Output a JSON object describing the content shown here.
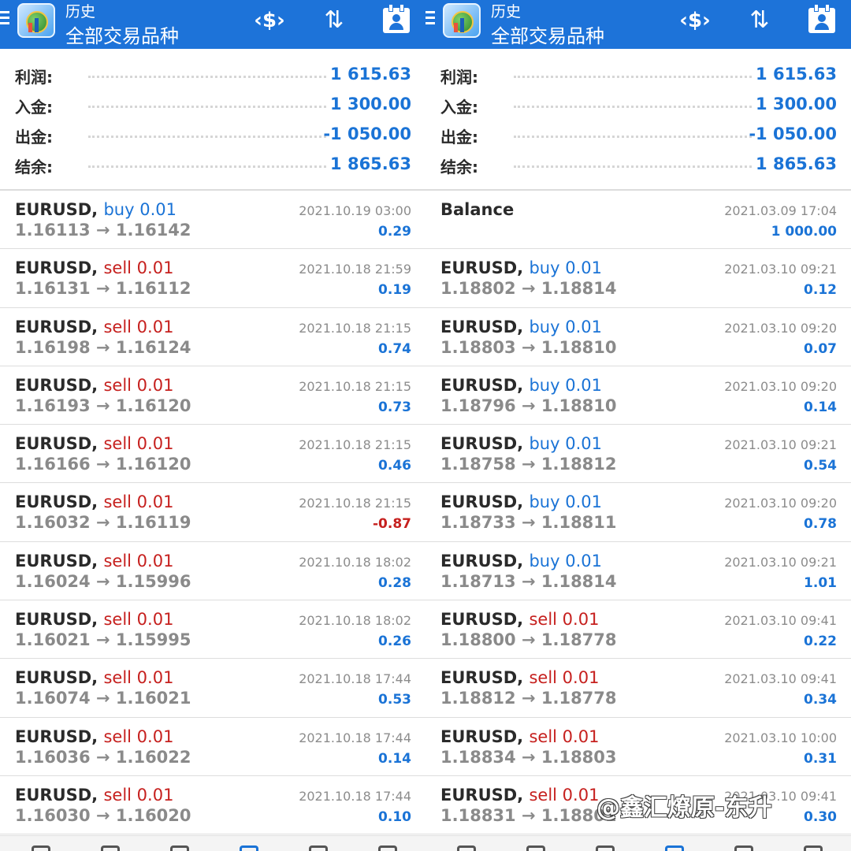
{
  "left": {
    "header": {
      "section": "历史",
      "filter": "全部交易品种"
    },
    "summary": [
      {
        "label": "利润:",
        "value": "1 615.63"
      },
      {
        "label": "入金:",
        "value": "1 300.00"
      },
      {
        "label": "出金:",
        "value": "-1 050.00"
      },
      {
        "label": "结余:",
        "value": "1 865.63"
      }
    ],
    "trades": [
      {
        "symbol": "EURUSD,",
        "side": "buy 0.01",
        "side_type": "buy",
        "prices": "1.16113 → 1.16142",
        "time": "2021.10.19 03:00",
        "profit": "0.29",
        "neg": false
      },
      {
        "symbol": "EURUSD,",
        "side": "sell 0.01",
        "side_type": "sell",
        "prices": "1.16131 → 1.16112",
        "time": "2021.10.18 21:59",
        "profit": "0.19",
        "neg": false
      },
      {
        "symbol": "EURUSD,",
        "side": "sell 0.01",
        "side_type": "sell",
        "prices": "1.16198 → 1.16124",
        "time": "2021.10.18 21:15",
        "profit": "0.74",
        "neg": false
      },
      {
        "symbol": "EURUSD,",
        "side": "sell 0.01",
        "side_type": "sell",
        "prices": "1.16193 → 1.16120",
        "time": "2021.10.18 21:15",
        "profit": "0.73",
        "neg": false
      },
      {
        "symbol": "EURUSD,",
        "side": "sell 0.01",
        "side_type": "sell",
        "prices": "1.16166 → 1.16120",
        "time": "2021.10.18 21:15",
        "profit": "0.46",
        "neg": false
      },
      {
        "symbol": "EURUSD,",
        "side": "sell 0.01",
        "side_type": "sell",
        "prices": "1.16032 → 1.16119",
        "time": "2021.10.18 21:15",
        "profit": "-0.87",
        "neg": true
      },
      {
        "symbol": "EURUSD,",
        "side": "sell 0.01",
        "side_type": "sell",
        "prices": "1.16024 → 1.15996",
        "time": "2021.10.18 18:02",
        "profit": "0.28",
        "neg": false
      },
      {
        "symbol": "EURUSD,",
        "side": "sell 0.01",
        "side_type": "sell",
        "prices": "1.16021 → 1.15995",
        "time": "2021.10.18 18:02",
        "profit": "0.26",
        "neg": false
      },
      {
        "symbol": "EURUSD,",
        "side": "sell 0.01",
        "side_type": "sell",
        "prices": "1.16074 → 1.16021",
        "time": "2021.10.18 17:44",
        "profit": "0.53",
        "neg": false
      },
      {
        "symbol": "EURUSD,",
        "side": "sell 0.01",
        "side_type": "sell",
        "prices": "1.16036 → 1.16022",
        "time": "2021.10.18 17:44",
        "profit": "0.14",
        "neg": false
      },
      {
        "symbol": "EURUSD,",
        "side": "sell 0.01",
        "side_type": "sell",
        "prices": "1.16030 → 1.16020",
        "time": "2021.10.18 17:44",
        "profit": "0.10",
        "neg": false
      }
    ]
  },
  "right": {
    "header": {
      "section": "历史",
      "filter": "全部交易品种"
    },
    "summary": [
      {
        "label": "利润:",
        "value": "1 615.63"
      },
      {
        "label": "入金:",
        "value": "1 300.00"
      },
      {
        "label": "出金:",
        "value": "-1 050.00"
      },
      {
        "label": "结余:",
        "value": "1 865.63"
      }
    ],
    "trades": [
      {
        "symbol": "Balance",
        "side": "",
        "side_type": "none",
        "prices": "",
        "time": "2021.03.09 17:04",
        "profit": "1 000.00",
        "neg": false
      },
      {
        "symbol": "EURUSD,",
        "side": "buy 0.01",
        "side_type": "buy",
        "prices": "1.18802 → 1.18814",
        "time": "2021.03.10 09:21",
        "profit": "0.12",
        "neg": false
      },
      {
        "symbol": "EURUSD,",
        "side": "buy 0.01",
        "side_type": "buy",
        "prices": "1.18803 → 1.18810",
        "time": "2021.03.10 09:20",
        "profit": "0.07",
        "neg": false
      },
      {
        "symbol": "EURUSD,",
        "side": "buy 0.01",
        "side_type": "buy",
        "prices": "1.18796 → 1.18810",
        "time": "2021.03.10 09:20",
        "profit": "0.14",
        "neg": false
      },
      {
        "symbol": "EURUSD,",
        "side": "buy 0.01",
        "side_type": "buy",
        "prices": "1.18758 → 1.18812",
        "time": "2021.03.10 09:21",
        "profit": "0.54",
        "neg": false
      },
      {
        "symbol": "EURUSD,",
        "side": "buy 0.01",
        "side_type": "buy",
        "prices": "1.18733 → 1.18811",
        "time": "2021.03.10 09:20",
        "profit": "0.78",
        "neg": false
      },
      {
        "symbol": "EURUSD,",
        "side": "buy 0.01",
        "side_type": "buy",
        "prices": "1.18713 → 1.18814",
        "time": "2021.03.10 09:21",
        "profit": "1.01",
        "neg": false
      },
      {
        "symbol": "EURUSD,",
        "side": "sell 0.01",
        "side_type": "sell",
        "prices": "1.18800 → 1.18778",
        "time": "2021.03.10 09:41",
        "profit": "0.22",
        "neg": false
      },
      {
        "symbol": "EURUSD,",
        "side": "sell 0.01",
        "side_type": "sell",
        "prices": "1.18812 → 1.18778",
        "time": "2021.03.10 09:41",
        "profit": "0.34",
        "neg": false
      },
      {
        "symbol": "EURUSD,",
        "side": "sell 0.01",
        "side_type": "sell",
        "prices": "1.18834 → 1.18803",
        "time": "2021.03.10 10:00",
        "profit": "0.31",
        "neg": false
      },
      {
        "symbol": "EURUSD,",
        "side": "sell 0.01",
        "side_type": "sell",
        "prices": "1.18831 → 1.18801",
        "time": "2021.03.10 09:41",
        "profit": "0.30",
        "neg": false
      }
    ]
  },
  "watermark": "@鑫汇燎原-东升",
  "colors": {
    "header_bg": "#1d73d9",
    "buy": "#1a73d6",
    "sell": "#c6201e",
    "profit_positive": "#1a73d6",
    "profit_negative": "#c6201e"
  }
}
